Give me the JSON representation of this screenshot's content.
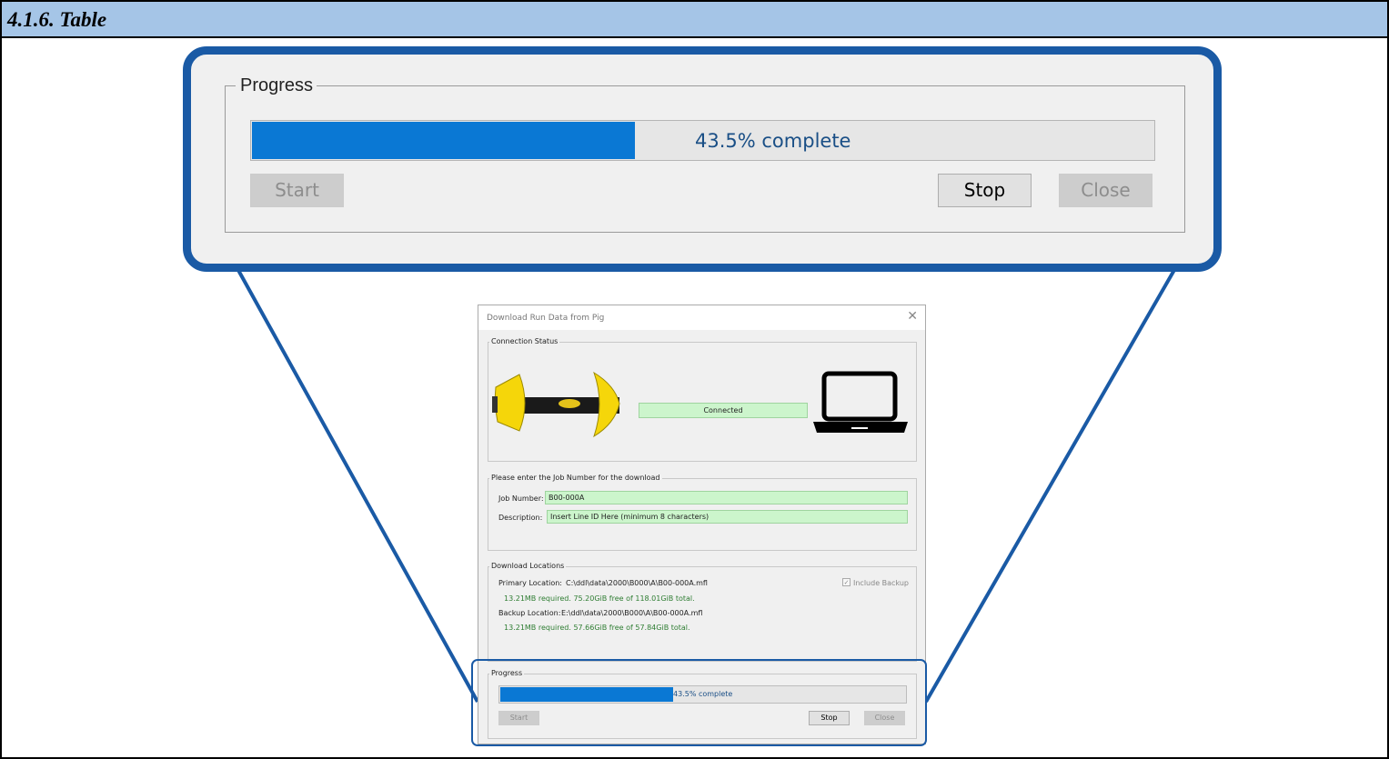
{
  "heading": "4.1.6. Table",
  "colors": {
    "accent": "#1a5aa5",
    "progress_fill": "#0a78d4",
    "heading_bar": "#a5c5e7",
    "field_green": "#ccf5cc"
  },
  "progress": {
    "legend": "Progress",
    "fraction": 0.435,
    "text": "43.5% complete",
    "start_label": "Start",
    "stop_label": "Stop",
    "close_label": "Close"
  },
  "dialog": {
    "title": "Download Run Data from Pig",
    "close_icon": "close-icon",
    "connection": {
      "legend": "Connection Status",
      "status": "Connected",
      "device_icon": "pig-device-icon",
      "computer_icon": "laptop-icon"
    },
    "job": {
      "legend": "Please enter the Job Number for the download",
      "job_label": "Job Number:",
      "job_value": "B00-000A",
      "desc_label": "Description:",
      "desc_value": "Insert Line ID Here (minimum 8 characters)"
    },
    "locations": {
      "legend": "Download Locations",
      "primary_label": "Primary Location:",
      "primary_path": "C:\\ddl\\data\\2000\\B000\\A\\B00-000A.mfl",
      "primary_info": "13.21MB required. 75.20GiB free of 118.01GiB total.",
      "backup_label": "Backup Location:",
      "backup_path": "E:\\ddl\\data\\2000\\B000\\A\\B00-000A.mfl",
      "backup_info": "13.21MB required. 57.66GiB free of 57.84GiB total.",
      "include_backup": "Include Backup",
      "include_backup_checked": true
    }
  }
}
